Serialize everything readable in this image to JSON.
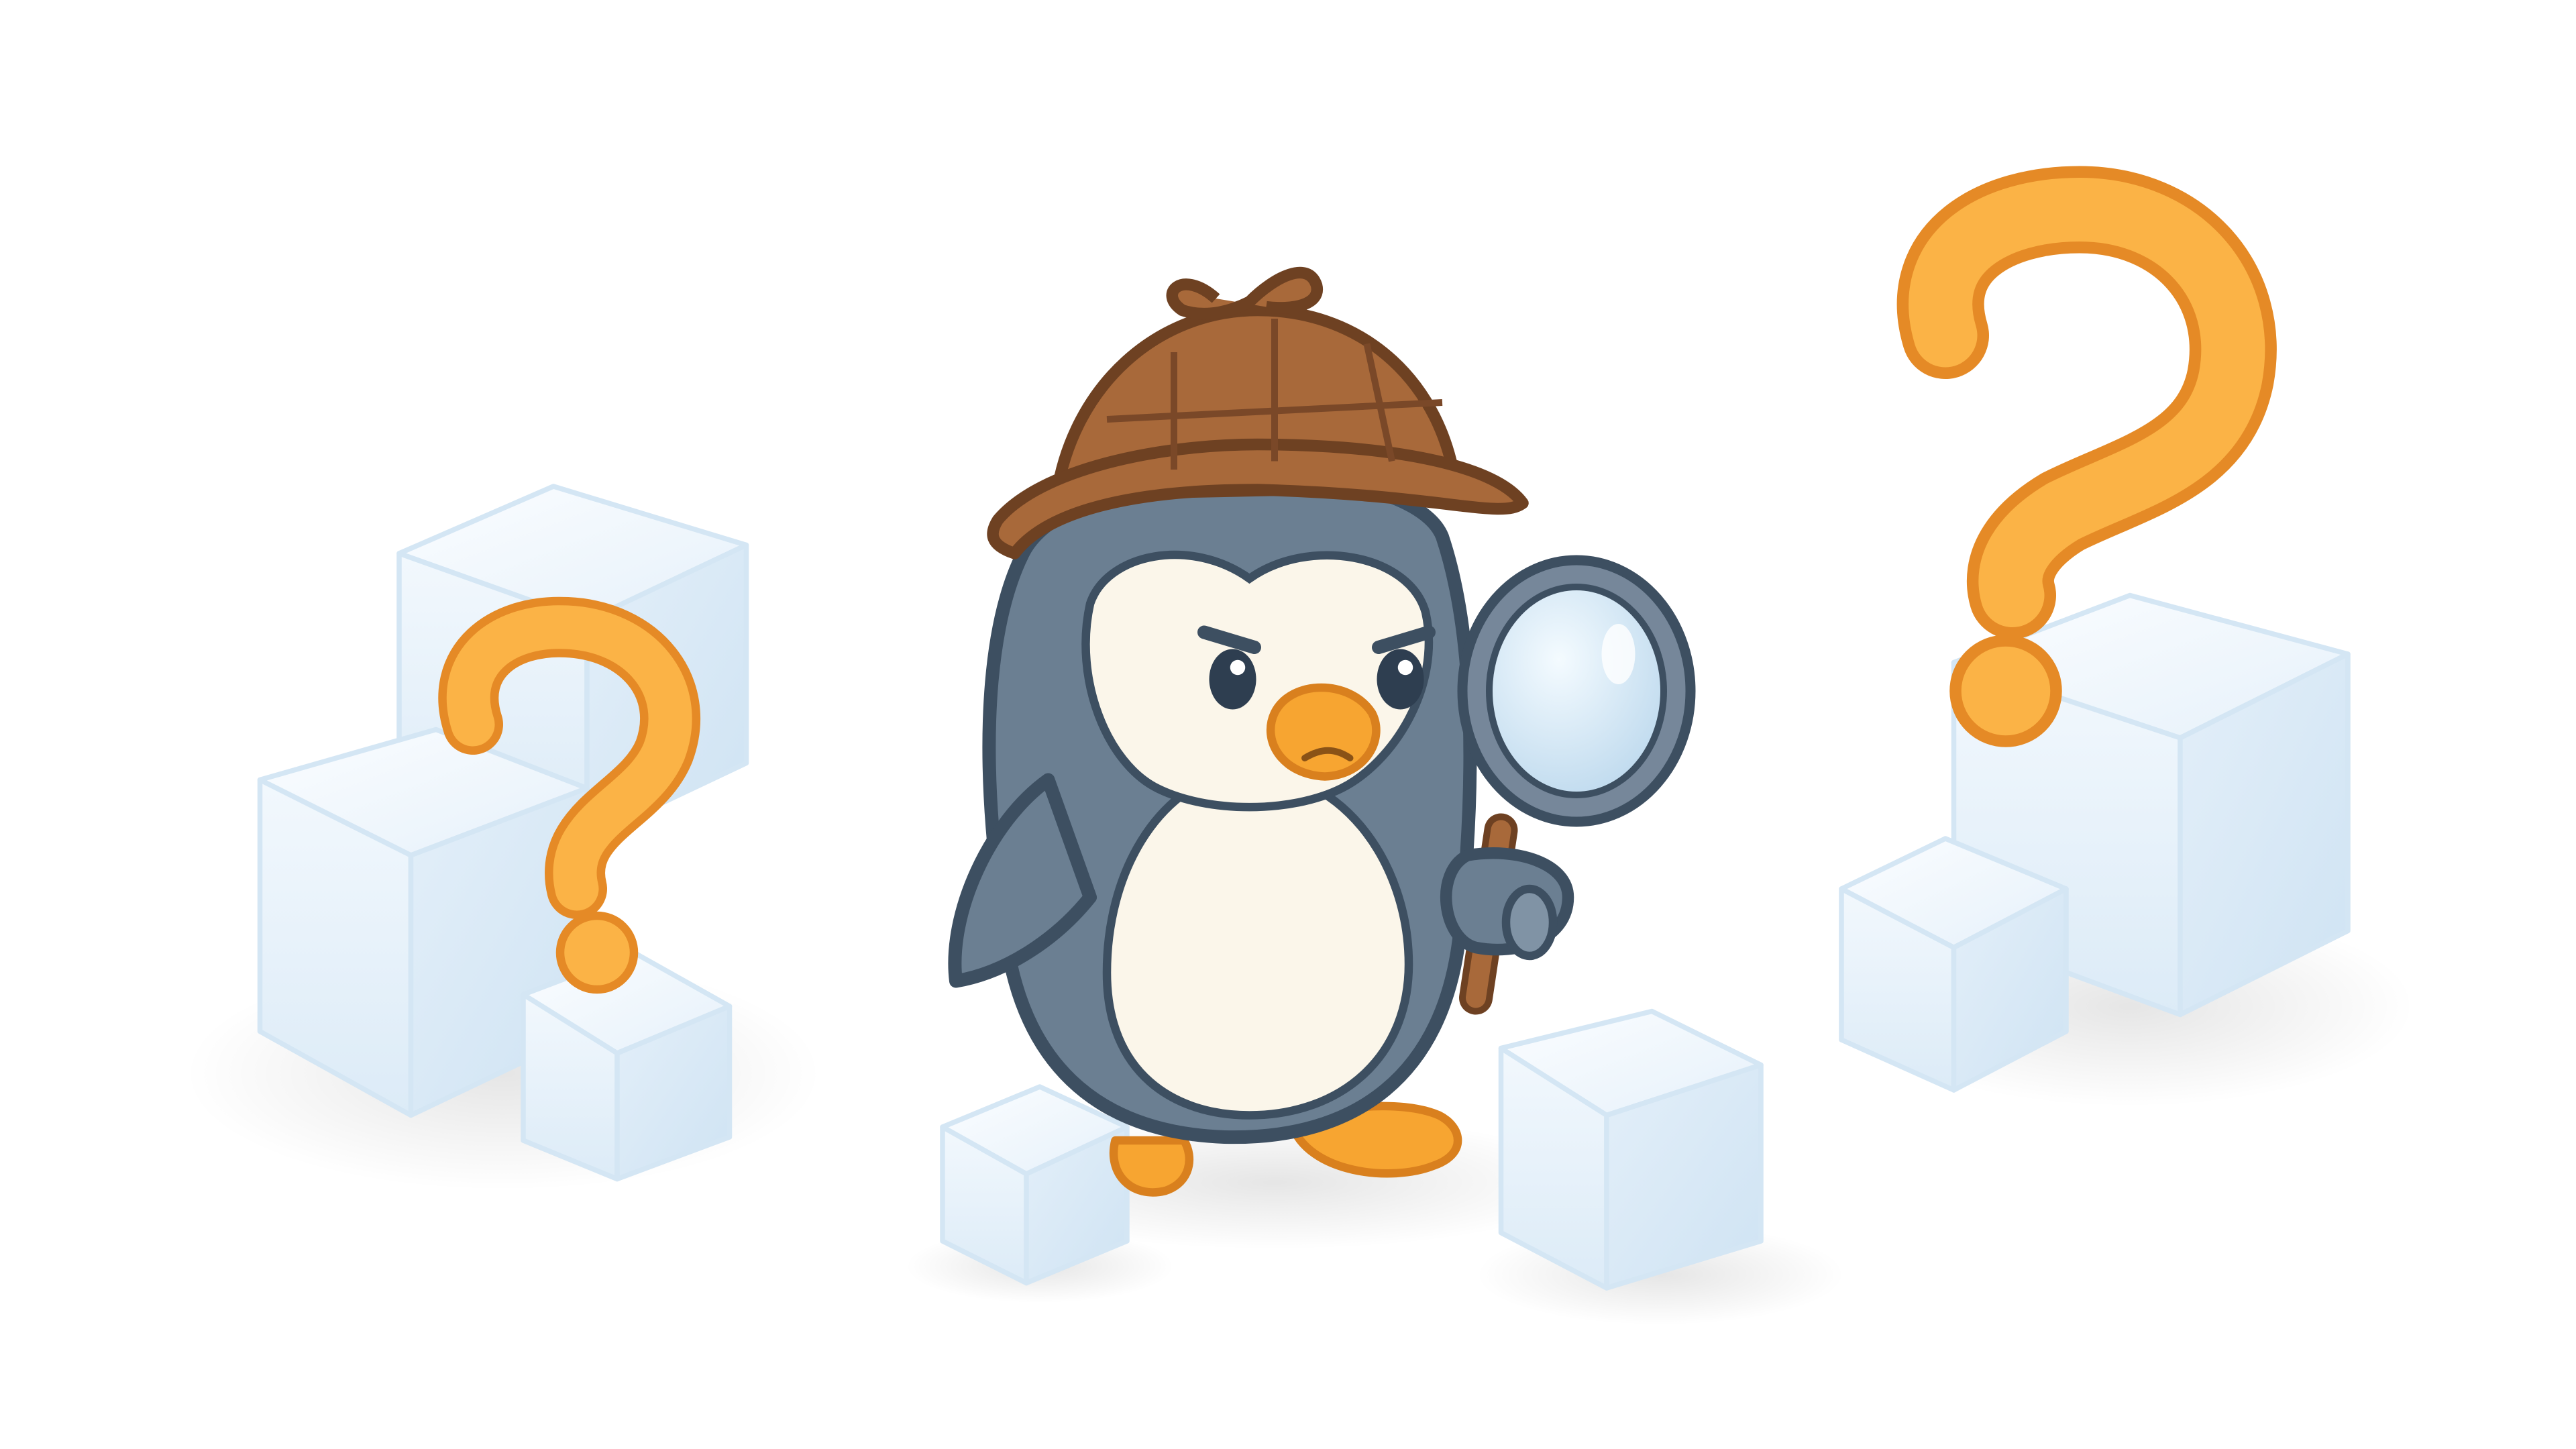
{
  "scene": {
    "subject": "penguin-detective",
    "props": [
      "deerstalker-hat",
      "magnifying-glass",
      "ice-cubes",
      "question-marks"
    ]
  },
  "palette": {
    "background": "#ffffff",
    "penguin_body": "#6b7f92",
    "penguin_outline": "#3d4f61",
    "penguin_belly": "#fbf6ea",
    "beak": "#f7a531",
    "beak_outline": "#d9801e",
    "hat": "#a8693a",
    "hat_outline": "#6e4122",
    "question_mark": "#fbb346",
    "question_outline": "#e58a26",
    "ice_fill": "#e8f3fb",
    "ice_edge": "#cfe4f4",
    "lens": "#d9ecf7",
    "lens_frame": "#76879a"
  }
}
